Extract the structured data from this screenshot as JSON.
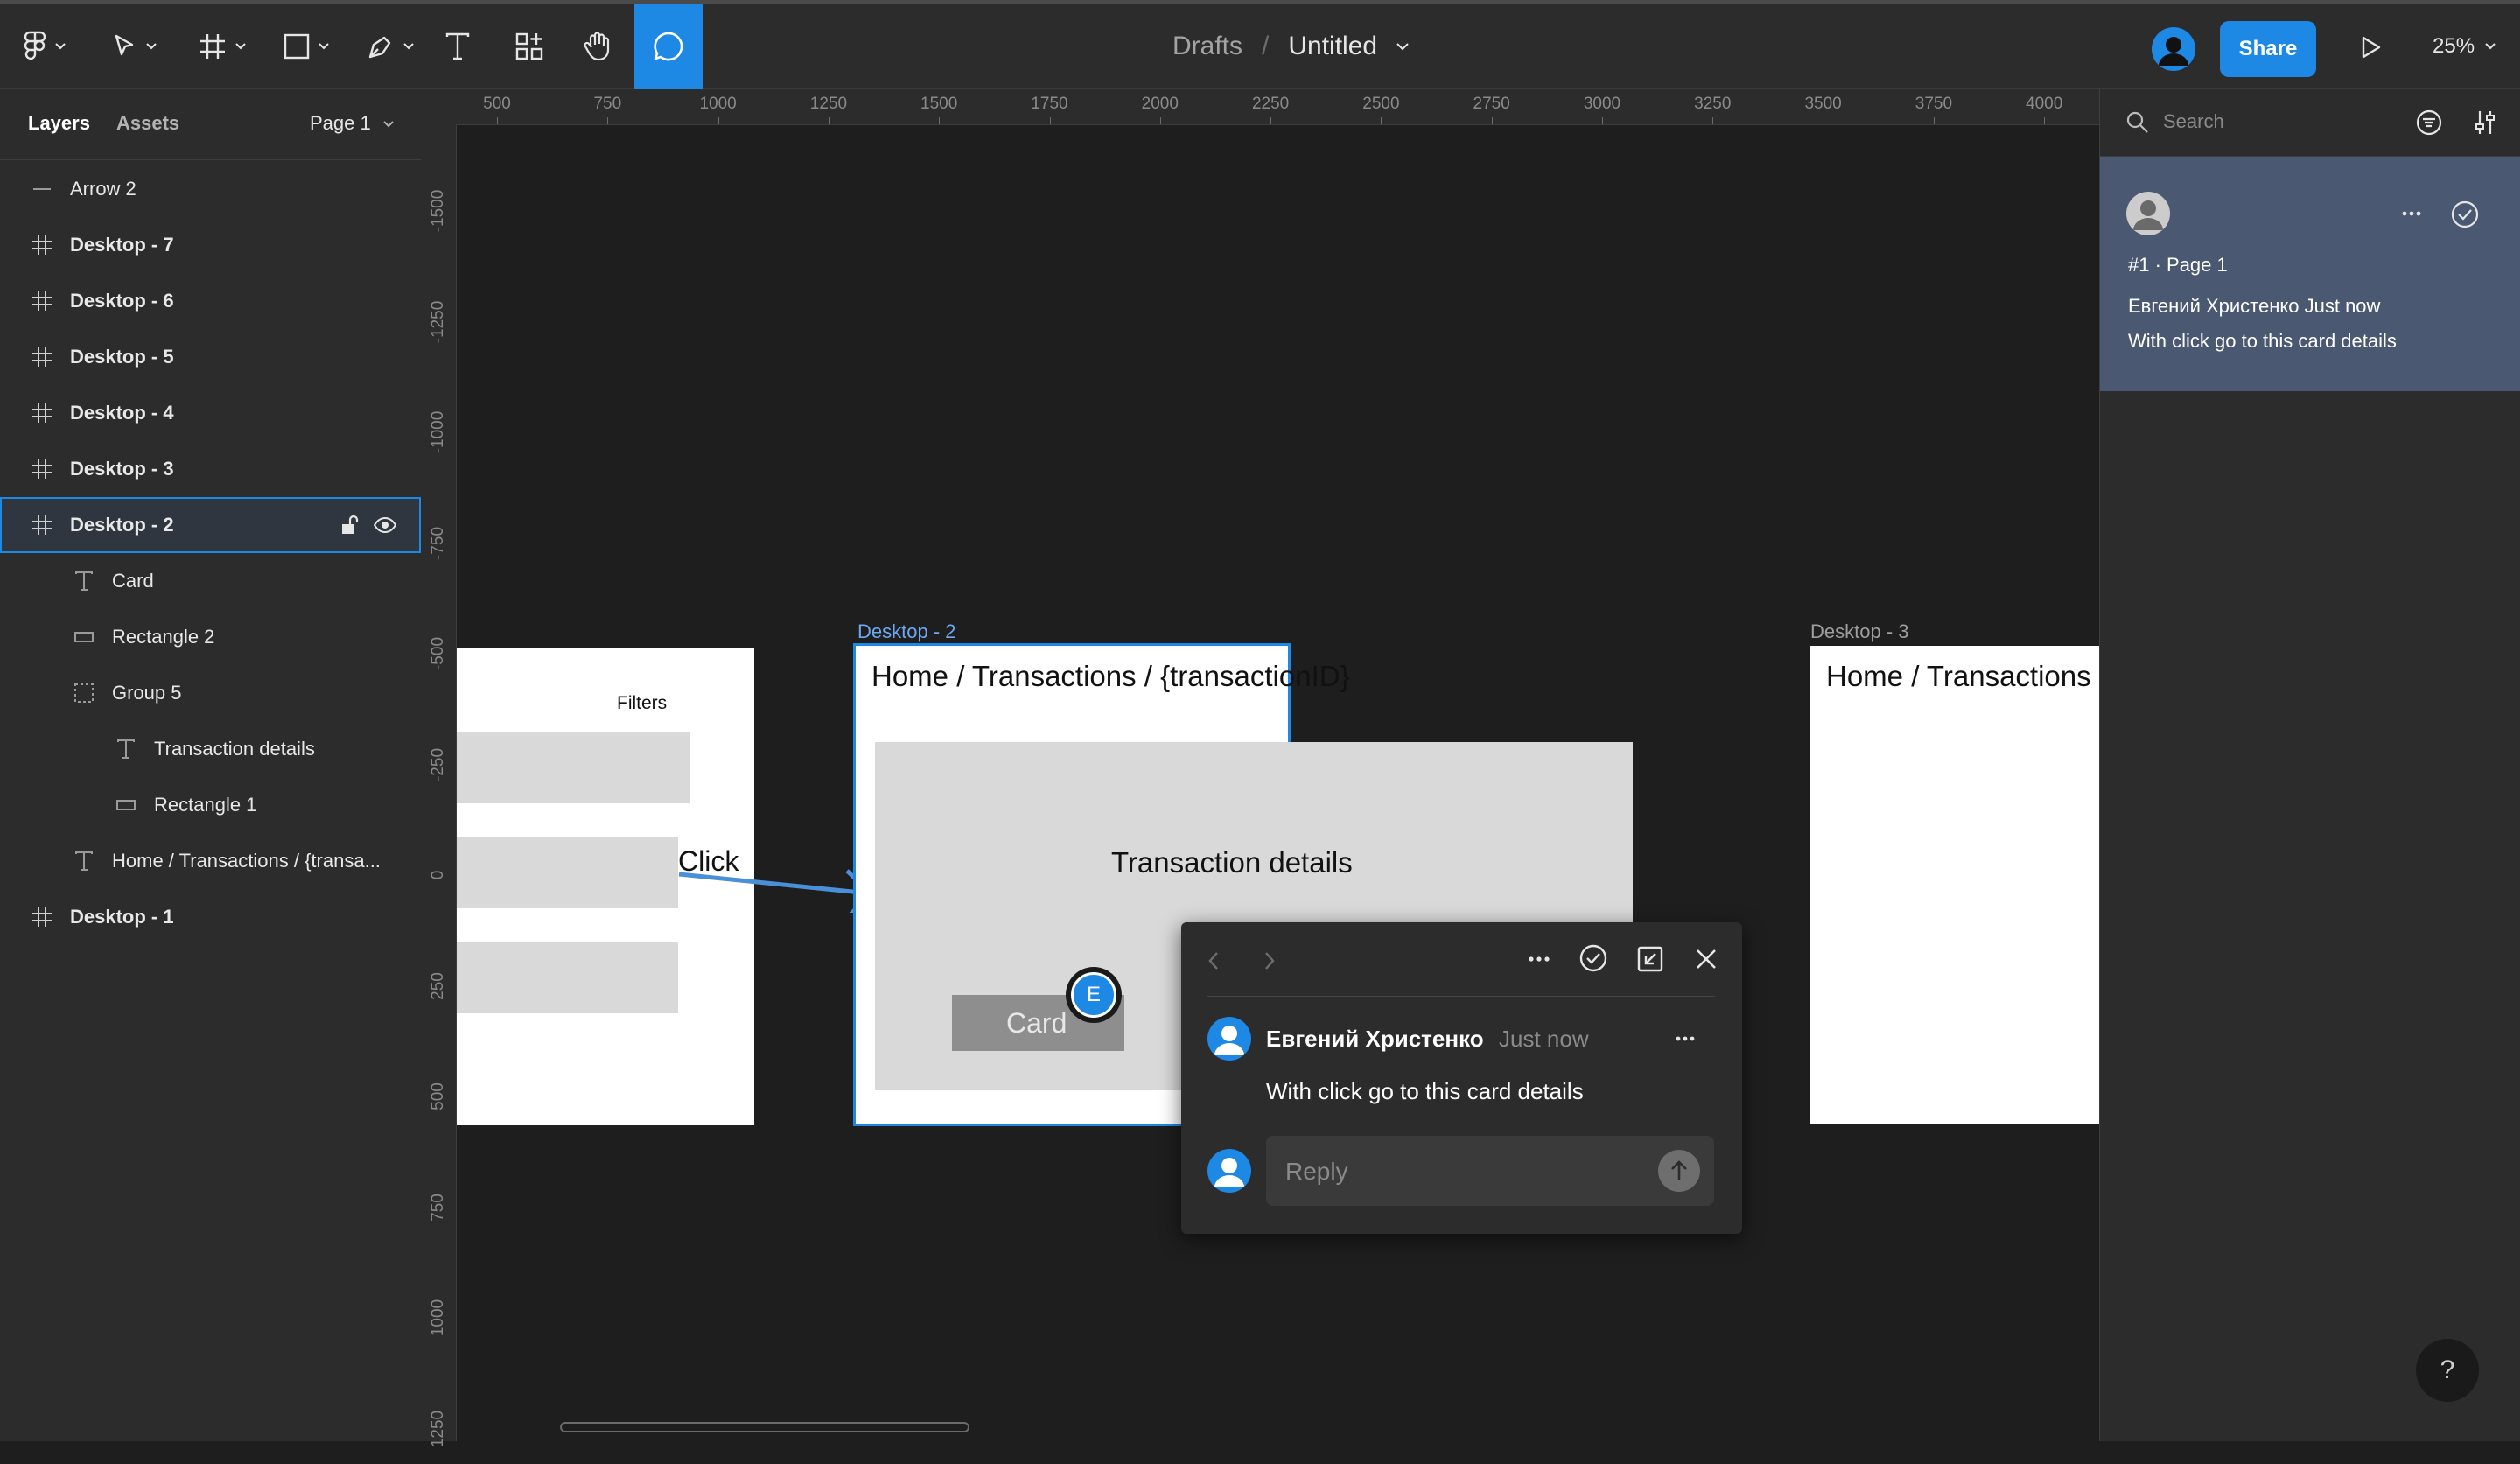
{
  "toolbar": {
    "breadcrumb_drafts": "Drafts",
    "breadcrumb_sep": "/",
    "file_title": "Untitled",
    "share_label": "Share",
    "zoom_label": "25%",
    "tools": [
      "figma-menu",
      "move",
      "frame",
      "shape",
      "pen",
      "text",
      "resources",
      "hand",
      "comment"
    ],
    "active_tool": "comment"
  },
  "left_panel": {
    "tab_layers": "Layers",
    "tab_assets": "Assets",
    "page_label": "Page 1",
    "layers": [
      {
        "label": "Arrow 2",
        "icon": "line-icon"
      },
      {
        "label": "Desktop - 7",
        "icon": "frame-icon"
      },
      {
        "label": "Desktop - 6",
        "icon": "frame-icon"
      },
      {
        "label": "Desktop - 5",
        "icon": "frame-icon"
      },
      {
        "label": "Desktop - 4",
        "icon": "frame-icon"
      },
      {
        "label": "Desktop - 3",
        "icon": "frame-icon"
      },
      {
        "label": "Desktop - 2",
        "icon": "frame-icon",
        "selected": true
      },
      {
        "label": "Card",
        "icon": "text-icon"
      },
      {
        "label": "Rectangle 2",
        "icon": "rectangle-icon"
      },
      {
        "label": "Group 5",
        "icon": "group-icon"
      },
      {
        "label": "Transaction details",
        "icon": "text-icon"
      },
      {
        "label": "Rectangle 1",
        "icon": "rectangle-icon"
      },
      {
        "label": "Home / Transactions / {transa...",
        "icon": "text-icon"
      },
      {
        "label": "Desktop - 1",
        "icon": "frame-icon"
      }
    ]
  },
  "rulers": {
    "top": [
      "500",
      "750",
      "1000",
      "1250",
      "1500",
      "1750",
      "2000",
      "2250",
      "2500",
      "2750",
      "3000",
      "3250",
      "3500",
      "3750",
      "4000"
    ],
    "left": [
      "-1500",
      "-1250",
      "-1000",
      "-750",
      "-500",
      "-250",
      "0",
      "250",
      "500",
      "750",
      "1000",
      "1250"
    ]
  },
  "canvas": {
    "desktop1": {
      "filters_label": "Filters",
      "click_label": "Click"
    },
    "desktop2": {
      "title": "Desktop - 2",
      "heading": "Home / Transactions / {transactionID}",
      "details_label": "Transaction details",
      "card_label": "Card"
    },
    "desktop3": {
      "title": "Desktop - 3",
      "heading": "Home / Transactions"
    },
    "comment_pin": "E"
  },
  "popup": {
    "author": "Евгений Христенко",
    "time": "Just now",
    "message": "With click go to this card details",
    "reply_placeholder": "Reply"
  },
  "right_panel": {
    "search_placeholder": "Search",
    "comment": {
      "meta": "#1 · Page 1",
      "author_line": "Евгений Христенко Just now",
      "message": "With click go to this card details"
    }
  },
  "help_label": "?",
  "colors": {
    "accent": "#1e88e5",
    "panel": "#2c2c2c",
    "canvas": "#1e1e1e",
    "comment_card": "#4a5872"
  }
}
